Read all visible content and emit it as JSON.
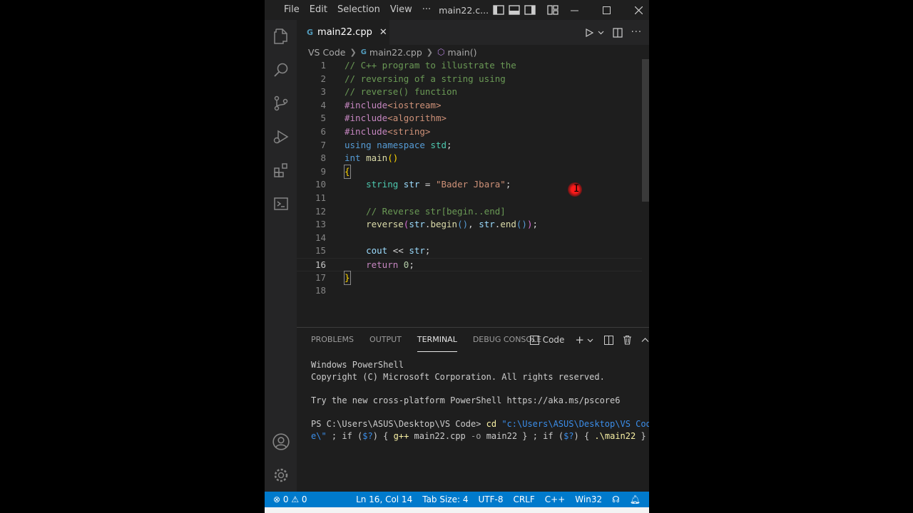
{
  "titlebar": {
    "menu": [
      "File",
      "Edit",
      "Selection",
      "View",
      "···"
    ],
    "title": "main22.c..."
  },
  "tab": {
    "label": "main22.cpp",
    "icon": "G"
  },
  "breadcrumb": {
    "folder": "VS Code",
    "file": "main22.cpp",
    "symbol": "main()"
  },
  "editor": {
    "active_line": 16
  },
  "panel": {
    "tabs": [
      "PROBLEMS",
      "OUTPUT",
      "TERMINAL",
      "DEBUG CONSOLE"
    ],
    "active_tab": "TERMINAL",
    "terminal_name": "Code"
  },
  "terminal": {
    "line1": "Windows PowerShell",
    "line2": "Copyright (C) Microsoft Corporation. All rights reserved.",
    "line3": "Try the new cross-platform PowerShell https://aka.ms/pscore6",
    "prompt": "PS C:\\Users\\ASUS\\Desktop\\VS Code> ",
    "cmd_cd": "cd",
    "path_str_a": " \"c:\\Users\\ASUS\\Desktop\\VS Cod",
    "path_str_b": "e\\\"",
    "sep1": " ; if (",
    "var1": "$?",
    "sep2": ") { ",
    "gpp": "g++",
    "gpp_args_a": " main22.cpp ",
    "flag_o": "-o",
    "gpp_args_b": " main22 } ; if (",
    "var2": "$?",
    "sep3": ") { ",
    "run": ".\\main22",
    "end": " }"
  },
  "statusbar": {
    "errors": "⊗ 0 ⚠ 0",
    "position": "Ln 16, Col 14",
    "tabsize": "Tab Size: 4",
    "encoding": "UTF-8",
    "eol": "CRLF",
    "language": "C++",
    "platform": "Win32"
  },
  "colors": {
    "statusbar": "#007acc",
    "editor_bg": "#1e1e1e",
    "activity_bg": "#252526"
  }
}
